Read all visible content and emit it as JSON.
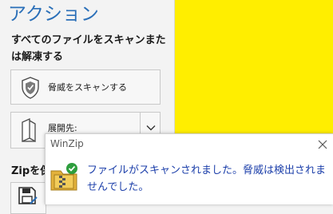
{
  "panel": {
    "title": "アクション",
    "section_heading": "すべてのファイルをスキャンまたは解凍する",
    "scan_button_label": "脅威をスキャンする",
    "extract_button_label": "展開先:",
    "zip_heading": "Zipを保"
  },
  "toast": {
    "app_name": "WinZip",
    "message": "ファイルがスキャンされました。脅威は検出されませんでした。"
  },
  "colors": {
    "title_blue": "#2a6fb8",
    "toast_text_blue": "#1c3faa",
    "yellow_background": "#ffee00",
    "check_green": "#2e9e3e"
  },
  "icons": {
    "scan": "shield-icon",
    "extract": "folder-open-icon",
    "dropdown": "chevron-down-icon",
    "save": "floppy-disk-icon",
    "close": "close-icon",
    "toast": "winzip-check-icon"
  }
}
